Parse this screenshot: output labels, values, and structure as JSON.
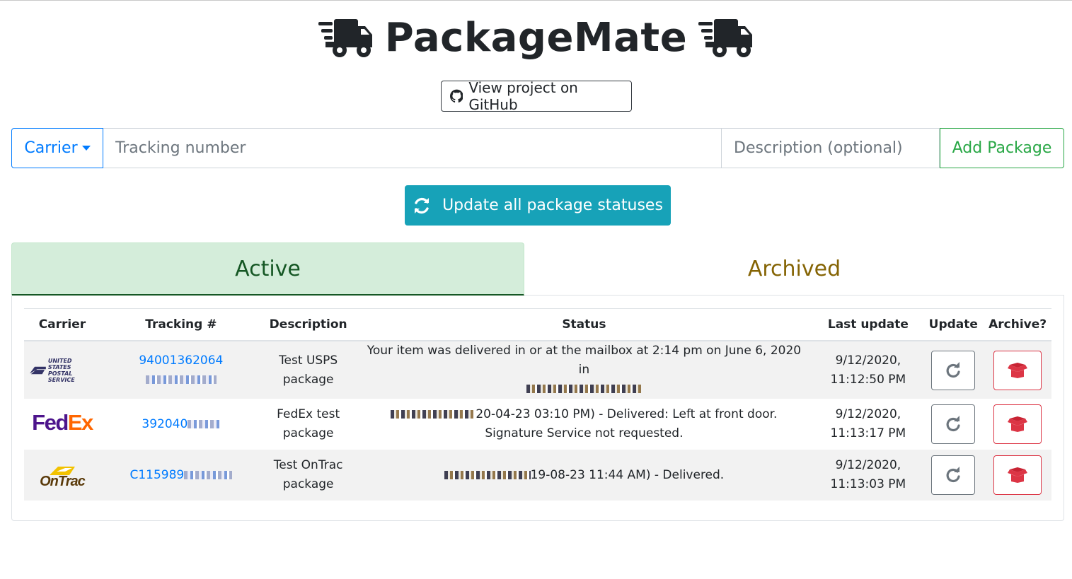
{
  "app": {
    "title": "PackageMate"
  },
  "header": {
    "github_label": "View project on GitHub"
  },
  "form": {
    "carrier_label": "Carrier",
    "tracking_placeholder": "Tracking number",
    "description_placeholder": "Description (optional)",
    "add_label": "Add Package"
  },
  "update_all_label": "Update all package statuses",
  "tabs": {
    "active": "Active",
    "archived": "Archived"
  },
  "table": {
    "headers": [
      "Carrier",
      "Tracking #",
      "Description",
      "Status",
      "Last update",
      "Update",
      "Archive?"
    ],
    "rows": [
      {
        "carrier": "USPS",
        "logo_text_1": "UNITED STATES",
        "logo_text_2": "POSTAL SERVICE",
        "tracking": "94001362064",
        "description": "Test USPS package",
        "status": "Your item was delivered in or at the mailbox at 2:14 pm on June 6, 2020 in",
        "last_update_date": "9/12/2020,",
        "last_update_time": "11:12:50 PM"
      },
      {
        "carrier": "FedEx",
        "logo_text_1": "Fed",
        "logo_text_2": "Ex",
        "tracking": "392040",
        "description": "FedEx test package",
        "status": "20-04-23 03:10 PM) - Delivered: Left at front door. Signature Service not requested.",
        "last_update_date": "9/12/2020,",
        "last_update_time": "11:13:17 PM"
      },
      {
        "carrier": "OnTrac",
        "logo_text_1": "OnTrac",
        "tracking": "C115989",
        "description": "Test OnTrac package",
        "status": "19-08-23 11:44 AM) - Delivered.",
        "last_update_date": "9/12/2020,",
        "last_update_time": "11:13:03 PM"
      }
    ]
  },
  "colors": {
    "primary": "#007bff",
    "success": "#28a745",
    "info": "#17a2b8",
    "danger": "#dc3545",
    "active_tab_bg": "#d4edda",
    "archived_tab_text": "#856404"
  },
  "icons": [
    "truck-icon",
    "github-icon",
    "sync-icon",
    "redo-icon",
    "box-open-icon"
  ]
}
